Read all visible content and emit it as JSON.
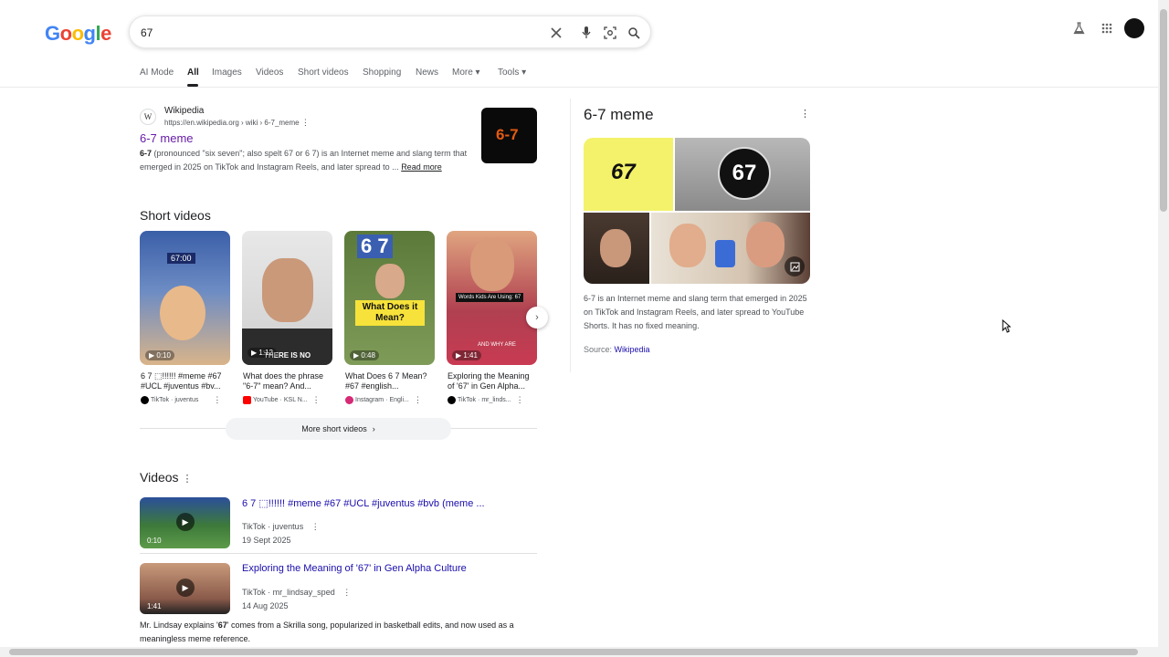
{
  "logo": {
    "letters": [
      "G",
      "o",
      "o",
      "g",
      "l",
      "e"
    ]
  },
  "search": {
    "query": "67"
  },
  "tabs": [
    "AI Mode",
    "All",
    "Images",
    "Videos",
    "Short videos",
    "Shopping",
    "News",
    "More ▾",
    "Tools ▾"
  ],
  "wiki_result": {
    "site": "Wikipedia",
    "url": "https://en.wikipedia.org › wiki › 6-7_meme",
    "title": "6-7 meme",
    "snippet_bold": "6-7",
    "snippet": " (pronounced \"six seven\"; also spelt 67 or 6 7) is an Internet meme and slang term that emerged in 2025 on TikTok and Instagram Reels, and later spread to ...",
    "read_more": "Read more",
    "thumb_text": "6-7"
  },
  "short_videos": {
    "heading": "Short videos",
    "items": [
      {
        "duration": "0:10",
        "title": "6 7 ⬚!!!!!! #meme #67 #UCL #juventus #bv...",
        "platform": "TikTok",
        "source": "juventus",
        "color": "#000000",
        "thumb_text": "67:00"
      },
      {
        "duration": "1:12",
        "title": "What does the phrase \"6-7\" mean? And...",
        "platform": "YouTube",
        "source": "KSL N...",
        "color": "#ff0000",
        "thumb_text": "THERE IS NO"
      },
      {
        "duration": "0:48",
        "title": "What Does 6 7 Mean? #67 #english...",
        "platform": "Instagram",
        "source": "Engli...",
        "color": "#d62976",
        "thumb_text": "What Does it Mean?"
      },
      {
        "duration": "1:41",
        "title": "Exploring the Meaning of '67' in Gen Alpha...",
        "platform": "TikTok",
        "source": "mr_linds...",
        "color": "#000000",
        "thumb_text": "Words Kids Are Using: 67"
      }
    ],
    "more_label": "More short videos"
  },
  "videos": {
    "heading": "Videos",
    "items": [
      {
        "duration": "0:10",
        "title": "6 7 ⬚!!!!!! #meme #67 #UCL #juventus #bvb (meme ...",
        "platform": "TikTok · juventus",
        "date": "19 Sept 2025"
      },
      {
        "duration": "1:41",
        "title": "Exploring the Meaning of '67' in Gen Alpha Culture",
        "platform": "TikTok · mr_lindsay_sped",
        "date": "14 Aug 2025",
        "desc_pre": "Mr. Lindsay explains '",
        "desc_bold": "67",
        "desc_post": "' comes from a Skrilla song, popularized in basketball edits, and now used as a meaningless meme reference."
      }
    ]
  },
  "knowledge_panel": {
    "title": "6-7 meme",
    "grid_text_a": "67",
    "grid_text_b": "67",
    "description": "6-7 is an Internet meme and slang term that emerged in 2025 on TikTok and Instagram Reels, and later spread to YouTube Shorts. It has no fixed meaning.",
    "source_label": "Source:",
    "source_link": "Wikipedia"
  }
}
